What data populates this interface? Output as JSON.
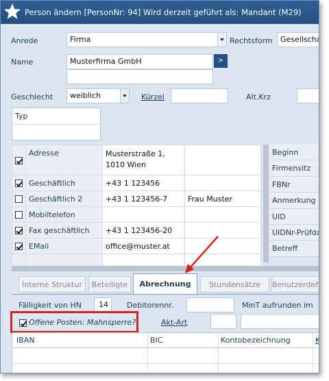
{
  "window": {
    "title": "Person ändern  [PersonNr: 94] Wird derzeit geführt als: Mandant (M29)"
  },
  "form": {
    "anrede_label": "Anrede",
    "anrede_value": "Firma",
    "rechtsform_label": "Rechtsform",
    "rechtsform_value": "Gesellschaft",
    "name_label": "Name",
    "name_value": "Musterfirma GmbH",
    "name_go_label": ">",
    "geschlecht_label": "Geschlecht",
    "geschlecht_value": "weiblich",
    "kuerzel_label": "Kürzel",
    "kuerzel_value": "",
    "altkrz_label": "Alt.Krz",
    "altkrz_value": "",
    "typ_label": "Typ"
  },
  "contacts": [
    {
      "checked": true,
      "type": "Adresse",
      "value": "Musterstraße 1,",
      "value2": "1010 Wien",
      "extra": ""
    },
    {
      "checked": true,
      "type": "Geschäftlich",
      "value": "+43 1 123456",
      "extra": ""
    },
    {
      "checked": false,
      "type": "Geschäftlich 2",
      "value": "+43 1 123456-7",
      "extra": "Frau Muster"
    },
    {
      "checked": false,
      "type": "Mobiltelefon",
      "value": "",
      "extra": ""
    },
    {
      "checked": true,
      "type": "Fax geschäftlich",
      "value": "+43 1 123456-20",
      "extra": ""
    },
    {
      "checked": true,
      "type": "EMail",
      "value": "office@muster.at",
      "extra": ""
    }
  ],
  "right_fields": [
    "Beginn",
    "Firmensitz",
    "FBNr",
    "Anmerkung",
    "UID",
    "UIDNr-Prüfdatum",
    "Betreff"
  ],
  "tabs": [
    {
      "label": "Interne Struktur",
      "active": false
    },
    {
      "label": "Beteiligte",
      "active": false
    },
    {
      "label": "Abrechnung",
      "active": true
    },
    {
      "label": "Stundensätze",
      "active": false
    },
    {
      "label": "Benutzerdefiniert",
      "active": false
    }
  ],
  "billing": {
    "faelligkeit_label": "Fälligkeit von HN",
    "faelligkeit_value": "14",
    "debitor_label": "Debitorennr.",
    "debitor_value": "",
    "mint_label": "MinT aufrunden im",
    "offene_posten_label": "Offene Posten: Mahnsperre?",
    "offene_posten_checked": true,
    "aktart_label": "Akt-Art",
    "aktart_value": ""
  },
  "bank_grid": {
    "columns": [
      "IBAN",
      "BIC",
      "Kontobezeichnung",
      "K"
    ]
  },
  "colors": {
    "titlebar": "#24507f",
    "background": "#dbe6f0",
    "highlight": "#d81e1e"
  }
}
